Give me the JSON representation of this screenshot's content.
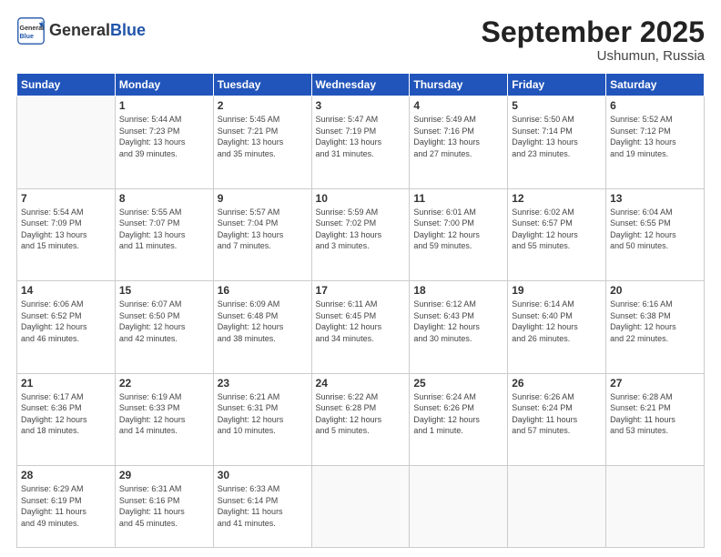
{
  "header": {
    "logo_general": "General",
    "logo_blue": "Blue",
    "month": "September 2025",
    "location": "Ushumun, Russia"
  },
  "weekdays": [
    "Sunday",
    "Monday",
    "Tuesday",
    "Wednesday",
    "Thursday",
    "Friday",
    "Saturday"
  ],
  "weeks": [
    [
      {
        "day": "",
        "info": ""
      },
      {
        "day": "1",
        "info": "Sunrise: 5:44 AM\nSunset: 7:23 PM\nDaylight: 13 hours\nand 39 minutes."
      },
      {
        "day": "2",
        "info": "Sunrise: 5:45 AM\nSunset: 7:21 PM\nDaylight: 13 hours\nand 35 minutes."
      },
      {
        "day": "3",
        "info": "Sunrise: 5:47 AM\nSunset: 7:19 PM\nDaylight: 13 hours\nand 31 minutes."
      },
      {
        "day": "4",
        "info": "Sunrise: 5:49 AM\nSunset: 7:16 PM\nDaylight: 13 hours\nand 27 minutes."
      },
      {
        "day": "5",
        "info": "Sunrise: 5:50 AM\nSunset: 7:14 PM\nDaylight: 13 hours\nand 23 minutes."
      },
      {
        "day": "6",
        "info": "Sunrise: 5:52 AM\nSunset: 7:12 PM\nDaylight: 13 hours\nand 19 minutes."
      }
    ],
    [
      {
        "day": "7",
        "info": "Sunrise: 5:54 AM\nSunset: 7:09 PM\nDaylight: 13 hours\nand 15 minutes."
      },
      {
        "day": "8",
        "info": "Sunrise: 5:55 AM\nSunset: 7:07 PM\nDaylight: 13 hours\nand 11 minutes."
      },
      {
        "day": "9",
        "info": "Sunrise: 5:57 AM\nSunset: 7:04 PM\nDaylight: 13 hours\nand 7 minutes."
      },
      {
        "day": "10",
        "info": "Sunrise: 5:59 AM\nSunset: 7:02 PM\nDaylight: 13 hours\nand 3 minutes."
      },
      {
        "day": "11",
        "info": "Sunrise: 6:01 AM\nSunset: 7:00 PM\nDaylight: 12 hours\nand 59 minutes."
      },
      {
        "day": "12",
        "info": "Sunrise: 6:02 AM\nSunset: 6:57 PM\nDaylight: 12 hours\nand 55 minutes."
      },
      {
        "day": "13",
        "info": "Sunrise: 6:04 AM\nSunset: 6:55 PM\nDaylight: 12 hours\nand 50 minutes."
      }
    ],
    [
      {
        "day": "14",
        "info": "Sunrise: 6:06 AM\nSunset: 6:52 PM\nDaylight: 12 hours\nand 46 minutes."
      },
      {
        "day": "15",
        "info": "Sunrise: 6:07 AM\nSunset: 6:50 PM\nDaylight: 12 hours\nand 42 minutes."
      },
      {
        "day": "16",
        "info": "Sunrise: 6:09 AM\nSunset: 6:48 PM\nDaylight: 12 hours\nand 38 minutes."
      },
      {
        "day": "17",
        "info": "Sunrise: 6:11 AM\nSunset: 6:45 PM\nDaylight: 12 hours\nand 34 minutes."
      },
      {
        "day": "18",
        "info": "Sunrise: 6:12 AM\nSunset: 6:43 PM\nDaylight: 12 hours\nand 30 minutes."
      },
      {
        "day": "19",
        "info": "Sunrise: 6:14 AM\nSunset: 6:40 PM\nDaylight: 12 hours\nand 26 minutes."
      },
      {
        "day": "20",
        "info": "Sunrise: 6:16 AM\nSunset: 6:38 PM\nDaylight: 12 hours\nand 22 minutes."
      }
    ],
    [
      {
        "day": "21",
        "info": "Sunrise: 6:17 AM\nSunset: 6:36 PM\nDaylight: 12 hours\nand 18 minutes."
      },
      {
        "day": "22",
        "info": "Sunrise: 6:19 AM\nSunset: 6:33 PM\nDaylight: 12 hours\nand 14 minutes."
      },
      {
        "day": "23",
        "info": "Sunrise: 6:21 AM\nSunset: 6:31 PM\nDaylight: 12 hours\nand 10 minutes."
      },
      {
        "day": "24",
        "info": "Sunrise: 6:22 AM\nSunset: 6:28 PM\nDaylight: 12 hours\nand 5 minutes."
      },
      {
        "day": "25",
        "info": "Sunrise: 6:24 AM\nSunset: 6:26 PM\nDaylight: 12 hours\nand 1 minute."
      },
      {
        "day": "26",
        "info": "Sunrise: 6:26 AM\nSunset: 6:24 PM\nDaylight: 11 hours\nand 57 minutes."
      },
      {
        "day": "27",
        "info": "Sunrise: 6:28 AM\nSunset: 6:21 PM\nDaylight: 11 hours\nand 53 minutes."
      }
    ],
    [
      {
        "day": "28",
        "info": "Sunrise: 6:29 AM\nSunset: 6:19 PM\nDaylight: 11 hours\nand 49 minutes."
      },
      {
        "day": "29",
        "info": "Sunrise: 6:31 AM\nSunset: 6:16 PM\nDaylight: 11 hours\nand 45 minutes."
      },
      {
        "day": "30",
        "info": "Sunrise: 6:33 AM\nSunset: 6:14 PM\nDaylight: 11 hours\nand 41 minutes."
      },
      {
        "day": "",
        "info": ""
      },
      {
        "day": "",
        "info": ""
      },
      {
        "day": "",
        "info": ""
      },
      {
        "day": "",
        "info": ""
      }
    ]
  ]
}
